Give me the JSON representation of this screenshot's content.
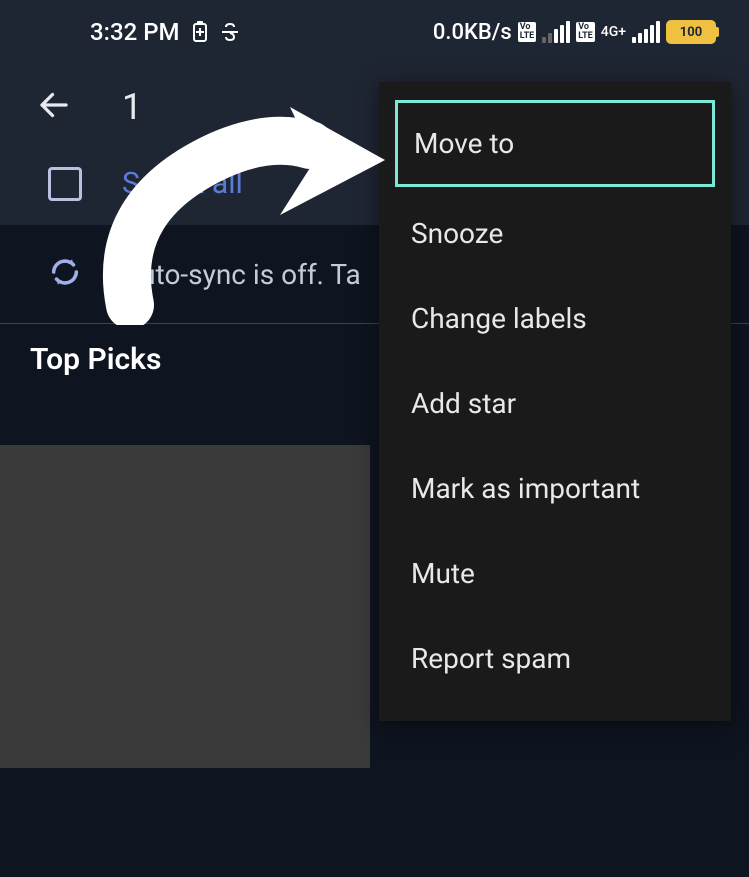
{
  "statusbar": {
    "time": "3:32 PM",
    "data_rate": "0.0KB/s",
    "lte1": "Vo LTE",
    "lte2": "Vo LTE",
    "net_label": "4G+",
    "battery_pct": "100"
  },
  "toolbar": {
    "selection_count": "1"
  },
  "select_all": {
    "label": "Select all"
  },
  "autosync": {
    "text": "Auto-sync is off. Ta"
  },
  "sections": {
    "top_picks": "Top Picks"
  },
  "menu": {
    "items": [
      "Move to",
      "Snooze",
      "Change labels",
      "Add star",
      "Mark as important",
      "Mute",
      "Report spam"
    ]
  }
}
